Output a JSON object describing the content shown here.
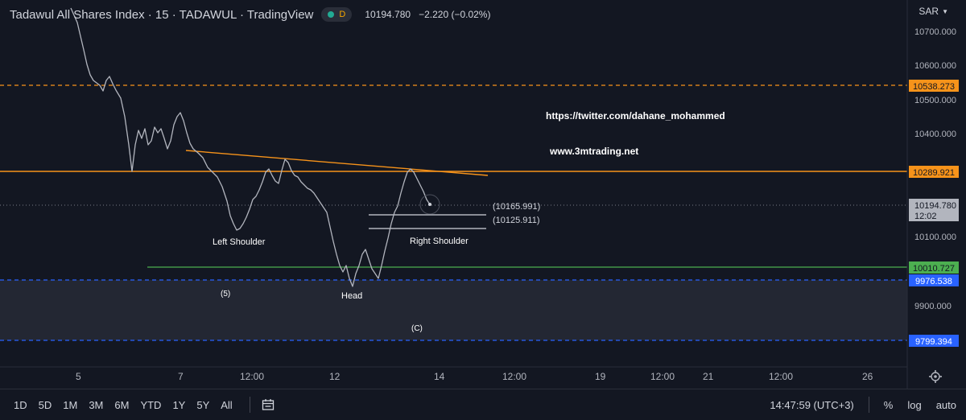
{
  "header": {
    "title": "Tadawul All Shares Index · 15 · TADAWUL · TradingView",
    "badge": "D",
    "price": "10194.780",
    "change": "−2.220 (−0.02%)",
    "currency": "SAR"
  },
  "price_axis": {
    "ticks": [
      "10700.000",
      "10600.000",
      "10500.000",
      "10400.000",
      "10100.000",
      "9900.000"
    ],
    "level_labels": [
      {
        "text": "10538.273",
        "color": "#f7931a"
      },
      {
        "text": "10289.921",
        "color": "#f7931a"
      },
      {
        "text": "10010.727",
        "color": "#4caf50"
      },
      {
        "text": "9976.538",
        "color": "#2962ff"
      },
      {
        "text": "9799.394",
        "color": "#2962ff"
      }
    ],
    "last_price": "10194.780",
    "countdown": "12:02"
  },
  "time_axis": {
    "ticks": [
      "5",
      "7",
      "12:00",
      "12",
      "14",
      "12:00",
      "19",
      "12:00",
      "21",
      "12:00",
      "26"
    ]
  },
  "annotations": {
    "link_twitter": "https://twitter.com/dahane_mohammed",
    "link_site": "www.3mtrading.net",
    "left_shoulder": "Left Shoulder",
    "head": "Head",
    "right_shoulder": "Right Shoulder",
    "wave5": "(5)",
    "waveC": "(C)",
    "level_a": "(10165.991)",
    "level_b": "(10125.911)"
  },
  "bottom_bar": {
    "ranges": [
      "1D",
      "5D",
      "1M",
      "3M",
      "6M",
      "YTD",
      "1Y",
      "5Y",
      "All"
    ],
    "clock": "14:47:59 (UTC+3)",
    "percent": "%",
    "log": "log",
    "auto": "auto"
  },
  "colors": {
    "background": "#131722",
    "price_line": "#b2b5be",
    "orange": "#f7931a",
    "green": "#4caf50",
    "blue": "#2962ff"
  }
}
